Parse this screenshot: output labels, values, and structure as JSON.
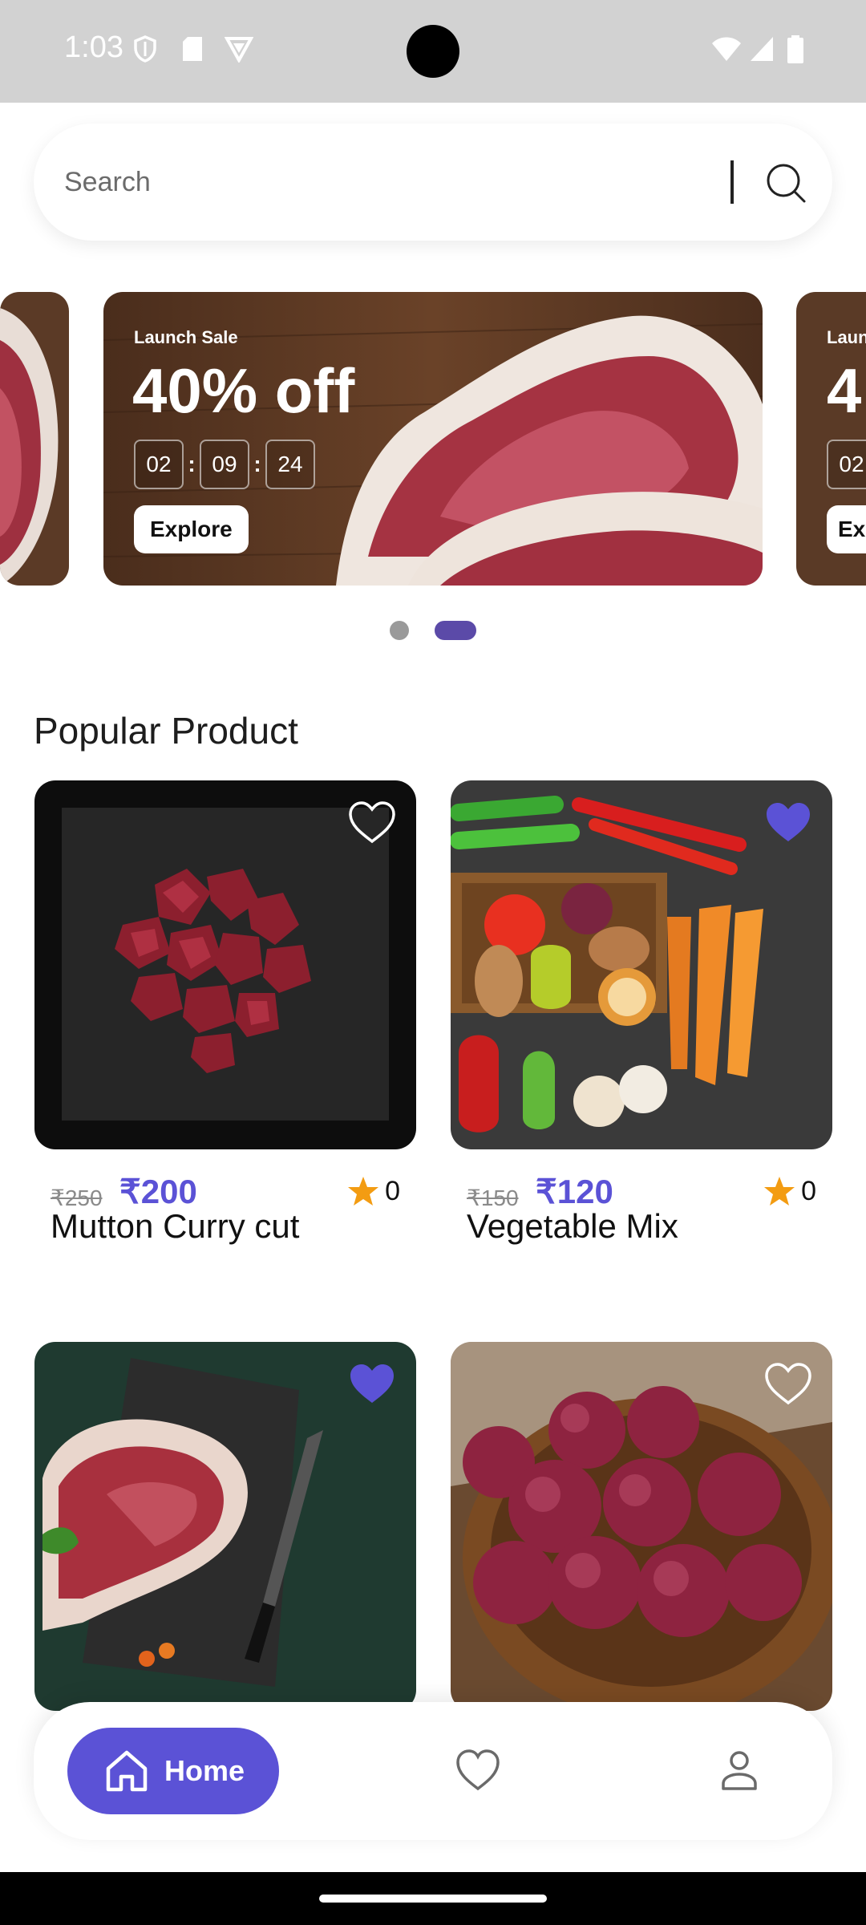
{
  "status_bar": {
    "time": "1:03"
  },
  "search": {
    "placeholder": "Search"
  },
  "carousel": {
    "banners": [
      {
        "label": "Launch Sale",
        "headline": "40% off",
        "timer": [
          "02",
          "09",
          "24"
        ],
        "button": "Explore"
      },
      {
        "label": "Launch Sale",
        "headline": "40% off",
        "timer": [
          "02",
          "09",
          "24"
        ],
        "button": "Explore"
      }
    ],
    "peek_right": {
      "label": "Laun",
      "headline": "4",
      "timer_first": "02",
      "button": "Ex"
    },
    "page_count": 2,
    "active_page": 2
  },
  "section": {
    "title": "Popular Product"
  },
  "products": [
    {
      "name": "Mutton Curry cut",
      "old_price": "₹250",
      "price": "₹200",
      "rating": "0",
      "favorited": false,
      "image_icon": "meat-cubes-image"
    },
    {
      "name": "Vegetable Mix",
      "old_price": "₹150",
      "price": "₹120",
      "rating": "0",
      "favorited": true,
      "image_icon": "vegetables-image"
    },
    {
      "name": "",
      "favorited": true,
      "image_icon": "steak-knife-image"
    },
    {
      "name": "",
      "favorited": false,
      "image_icon": "onion-basket-image"
    }
  ],
  "nav": {
    "home_label": "Home",
    "home_icon": "home-icon",
    "favorites_icon": "heart-icon",
    "profile_icon": "profile-icon"
  },
  "colors": {
    "accent": "#5b52d6",
    "star": "#f39c12",
    "status_bar": "#d2d2d2"
  }
}
